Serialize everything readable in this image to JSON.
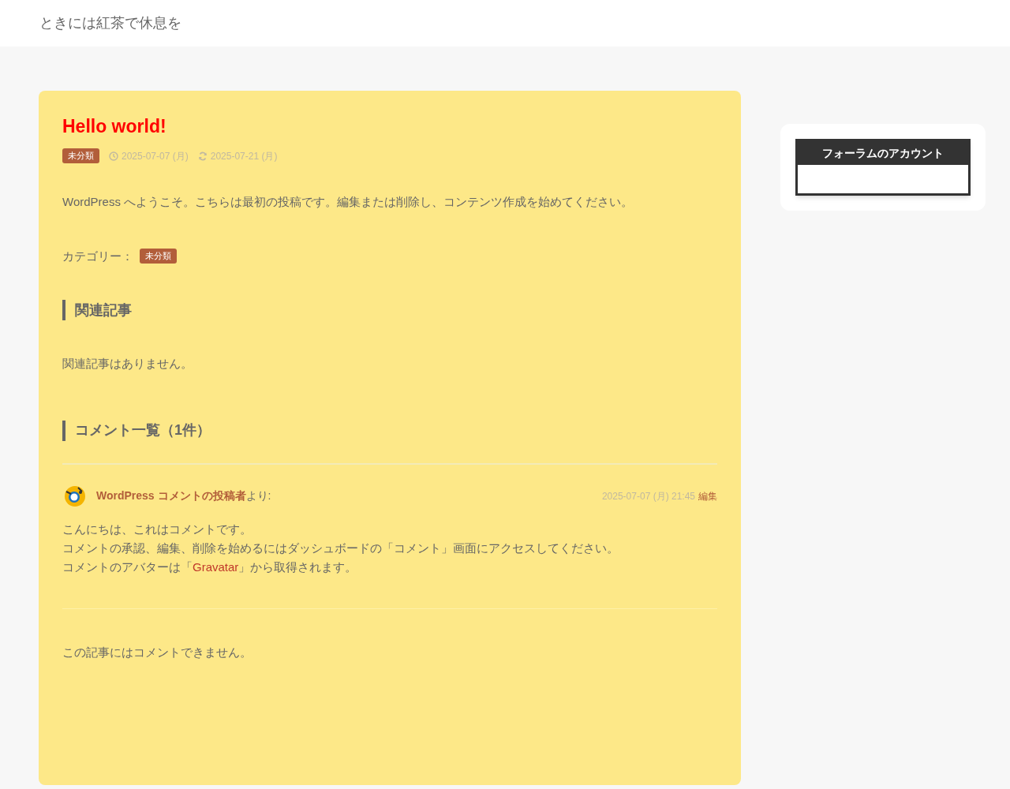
{
  "site_title": "ときには紅茶で休息を",
  "post": {
    "title": "Hello world!",
    "category_badge": "未分類",
    "published": "2025-07-07 (月)",
    "updated": "2025-07-21 (月)",
    "body": "WordPress へようこそ。こちらは最初の投稿です。編集または削除し、コンテンツ作成を始めてください。",
    "category_label": "カテゴリー：",
    "category_tag": "未分類"
  },
  "related": {
    "heading": "関連記事",
    "empty_text": "関連記事はありません。"
  },
  "comments": {
    "heading": "コメント一覧（1件）",
    "items": [
      {
        "author": "WordPress コメントの投稿者",
        "author_suffix": "より:",
        "date": "2025-07-07 (月) 21:45",
        "edit_link": "編集",
        "lines": [
          {
            "text": "こんにちは、これはコメントです。"
          },
          {
            "text": "コメントの承認、編集、削除を始めるにはダッシュボードの「コメント」画面にアクセスしてください。"
          },
          {
            "before": "コメントのアバターは「",
            "link": "Gravatar",
            "after": "」から取得されます。"
          }
        ]
      }
    ],
    "closed_text": "この記事にはコメントできません。"
  },
  "sidebar": {
    "widget_title": "フォーラムのアカウント"
  }
}
